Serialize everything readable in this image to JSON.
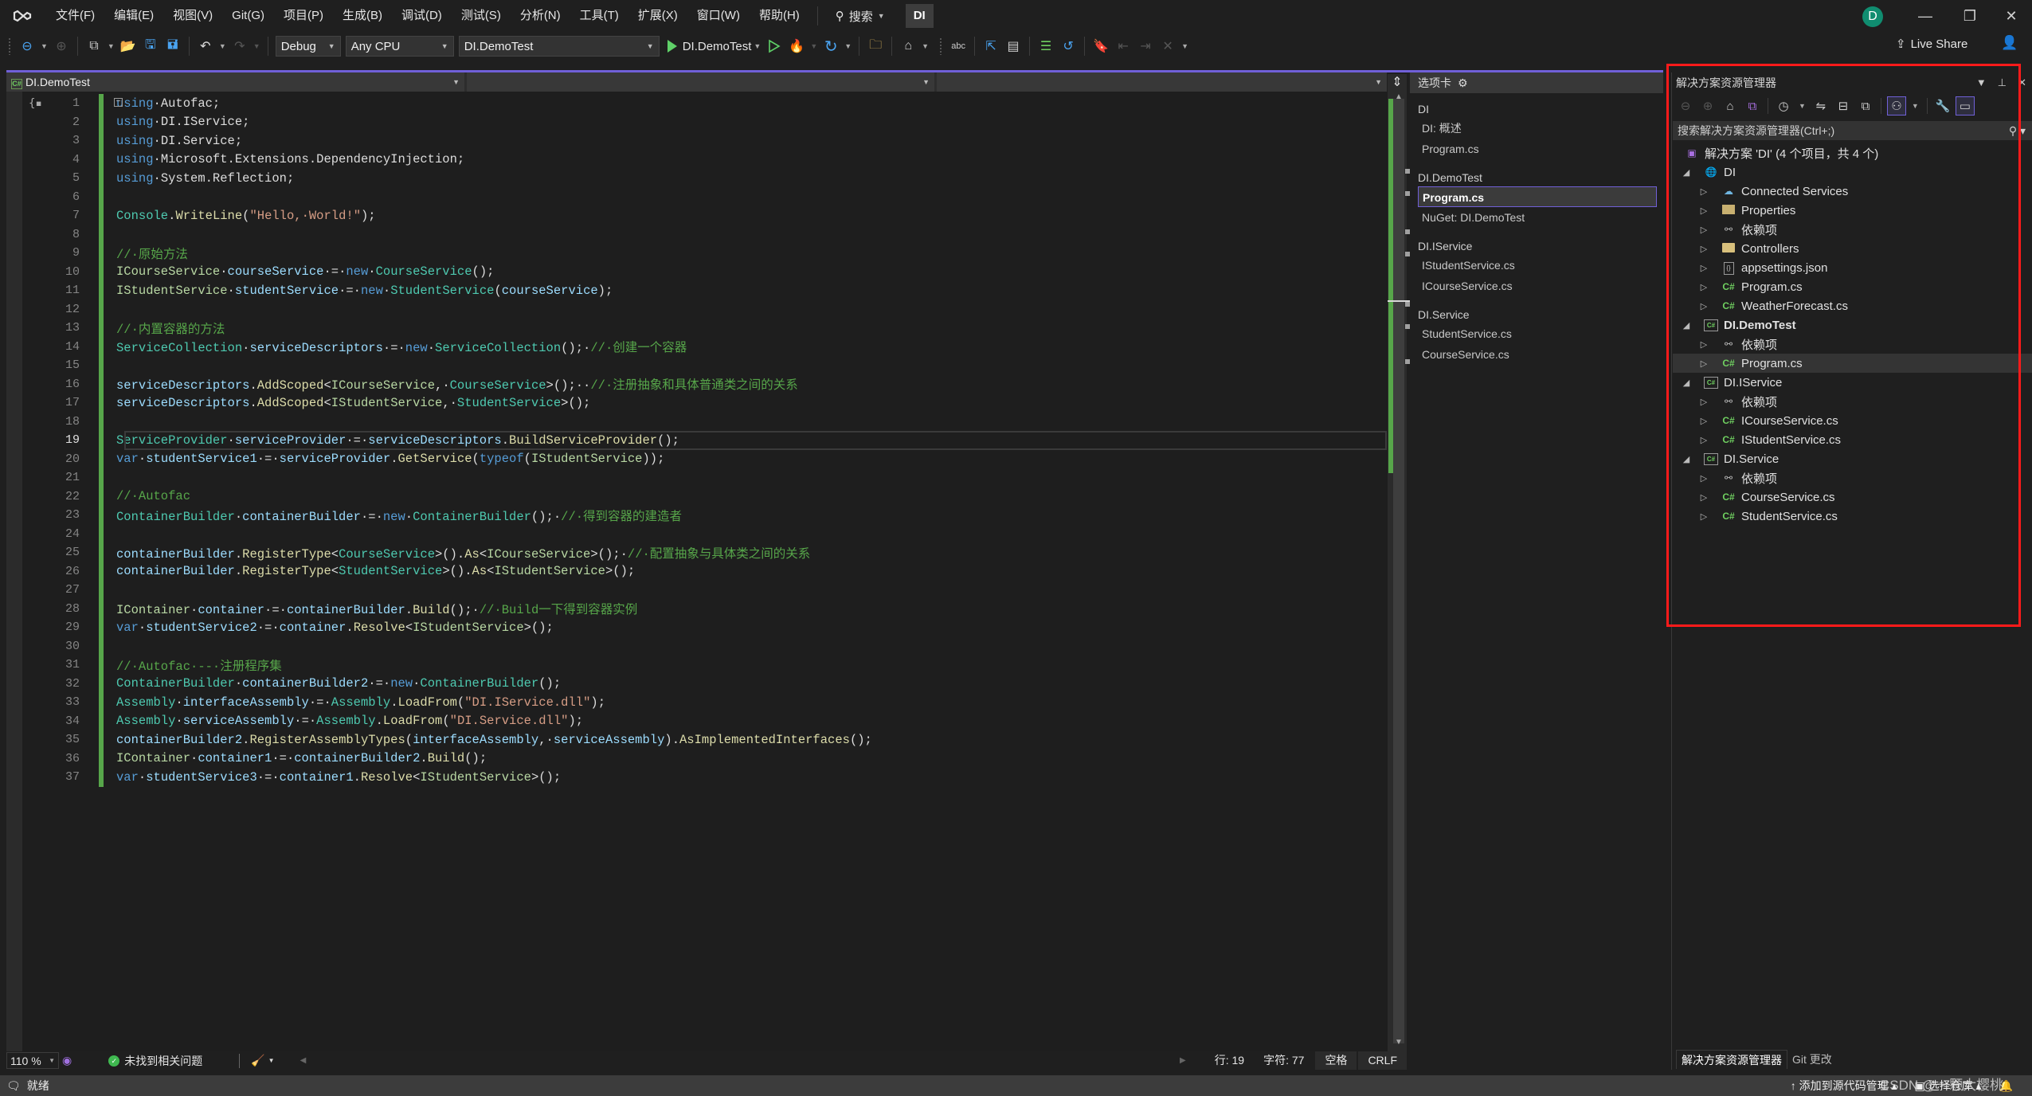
{
  "menubar": {
    "items": [
      "文件(F)",
      "编辑(E)",
      "视图(V)",
      "Git(G)",
      "项目(P)",
      "生成(B)",
      "调试(D)",
      "测试(S)",
      "分析(N)",
      "工具(T)",
      "扩展(X)",
      "窗口(W)",
      "帮助(H)"
    ],
    "search_label": "搜索",
    "solution_badge": "DI",
    "avatar_initial": "D"
  },
  "toolbar": {
    "configuration": "Debug",
    "platform": "Any CPU",
    "startup_project": "DI.DemoTest",
    "run_target": "DI.DemoTest",
    "live_share": "Live Share"
  },
  "editor": {
    "nav": {
      "project": "DI.DemoTest",
      "type": "",
      "member": ""
    },
    "current_line": 19,
    "lines": [
      {
        "n": 1,
        "tokens": [
          [
            "k",
            "using"
          ],
          [
            "",
            "·Autofac;"
          ]
        ]
      },
      {
        "n": 2,
        "tokens": [
          [
            "k",
            "using"
          ],
          [
            "",
            "·DI.IService;"
          ]
        ]
      },
      {
        "n": 3,
        "tokens": [
          [
            "k",
            "using"
          ],
          [
            "",
            "·DI.Service;"
          ]
        ]
      },
      {
        "n": 4,
        "tokens": [
          [
            "k",
            "using"
          ],
          [
            "",
            "·Microsoft.Extensions.DependencyInjection;"
          ]
        ]
      },
      {
        "n": 5,
        "tokens": [
          [
            "k",
            "using"
          ],
          [
            "",
            "·System.Reflection;"
          ]
        ]
      },
      {
        "n": 6,
        "tokens": []
      },
      {
        "n": 7,
        "tokens": [
          [
            "t",
            "Console"
          ],
          [
            "",
            "."
          ],
          [
            "m",
            "WriteLine"
          ],
          [
            "",
            "("
          ],
          [
            "s",
            "\"Hello,·World!\""
          ],
          [
            "",
            ");"
          ]
        ]
      },
      {
        "n": 8,
        "tokens": []
      },
      {
        "n": 9,
        "tokens": [
          [
            "c",
            "//·原始方法"
          ]
        ]
      },
      {
        "n": 10,
        "tokens": [
          [
            "iface",
            "ICourseService"
          ],
          [
            "",
            "·"
          ],
          [
            "v",
            "courseService"
          ],
          [
            "",
            "·=·"
          ],
          [
            "k",
            "new"
          ],
          [
            "",
            "·"
          ],
          [
            "t",
            "CourseService"
          ],
          [
            "",
            "();"
          ]
        ]
      },
      {
        "n": 11,
        "tokens": [
          [
            "iface",
            "IStudentService"
          ],
          [
            "",
            "·"
          ],
          [
            "v",
            "studentService"
          ],
          [
            "",
            "·=·"
          ],
          [
            "k",
            "new"
          ],
          [
            "",
            "·"
          ],
          [
            "t",
            "StudentService"
          ],
          [
            "",
            "("
          ],
          [
            "v",
            "courseService"
          ],
          [
            "",
            ");"
          ]
        ]
      },
      {
        "n": 12,
        "tokens": []
      },
      {
        "n": 13,
        "tokens": [
          [
            "c",
            "//·内置容器的方法"
          ]
        ]
      },
      {
        "n": 14,
        "tokens": [
          [
            "t",
            "ServiceCollection"
          ],
          [
            "",
            "·"
          ],
          [
            "v",
            "serviceDescriptors"
          ],
          [
            "",
            "·=·"
          ],
          [
            "k",
            "new"
          ],
          [
            "",
            "·"
          ],
          [
            "t",
            "ServiceCollection"
          ],
          [
            "",
            "();·"
          ],
          [
            "c",
            "//·创建一个容器"
          ]
        ]
      },
      {
        "n": 15,
        "tokens": []
      },
      {
        "n": 16,
        "tokens": [
          [
            "v",
            "serviceDescriptors"
          ],
          [
            "",
            "."
          ],
          [
            "m",
            "AddScoped"
          ],
          [
            "",
            "<"
          ],
          [
            "iface",
            "ICourseService"
          ],
          [
            "",
            ",·"
          ],
          [
            "t",
            "CourseService"
          ],
          [
            "",
            ">();··"
          ],
          [
            "c",
            "//·注册抽象和具体普通类之间的关系"
          ]
        ]
      },
      {
        "n": 17,
        "tokens": [
          [
            "v",
            "serviceDescriptors"
          ],
          [
            "",
            "."
          ],
          [
            "m",
            "AddScoped"
          ],
          [
            "",
            "<"
          ],
          [
            "iface",
            "IStudentService"
          ],
          [
            "",
            ",·"
          ],
          [
            "t",
            "StudentService"
          ],
          [
            "",
            ">();"
          ]
        ]
      },
      {
        "n": 18,
        "tokens": []
      },
      {
        "n": 19,
        "tokens": [
          [
            "t",
            "ServiceProvider"
          ],
          [
            "",
            "·"
          ],
          [
            "v",
            "serviceProvider"
          ],
          [
            "",
            "·=·"
          ],
          [
            "v",
            "serviceDescriptors"
          ],
          [
            "",
            "."
          ],
          [
            "m",
            "BuildServiceProvider"
          ],
          [
            "",
            "();"
          ]
        ]
      },
      {
        "n": 20,
        "tokens": [
          [
            "k",
            "var"
          ],
          [
            "",
            "·"
          ],
          [
            "v",
            "studentService1"
          ],
          [
            "",
            "·=·"
          ],
          [
            "v",
            "serviceProvider"
          ],
          [
            "",
            "."
          ],
          [
            "m",
            "GetService"
          ],
          [
            "",
            "("
          ],
          [
            "k",
            "typeof"
          ],
          [
            "",
            "("
          ],
          [
            "iface",
            "IStudentService"
          ],
          [
            "",
            "));"
          ]
        ]
      },
      {
        "n": 21,
        "tokens": []
      },
      {
        "n": 22,
        "tokens": [
          [
            "c",
            "//·Autofac"
          ]
        ]
      },
      {
        "n": 23,
        "tokens": [
          [
            "t",
            "ContainerBuilder"
          ],
          [
            "",
            "·"
          ],
          [
            "v",
            "containerBuilder"
          ],
          [
            "",
            "·=·"
          ],
          [
            "k",
            "new"
          ],
          [
            "",
            "·"
          ],
          [
            "t",
            "ContainerBuilder"
          ],
          [
            "",
            "();·"
          ],
          [
            "c",
            "//·得到容器的建造者"
          ]
        ]
      },
      {
        "n": 24,
        "tokens": []
      },
      {
        "n": 25,
        "tokens": [
          [
            "v",
            "containerBuilder"
          ],
          [
            "",
            "."
          ],
          [
            "m",
            "RegisterType"
          ],
          [
            "",
            "<"
          ],
          [
            "t",
            "CourseService"
          ],
          [
            "",
            ">()."
          ],
          [
            "m",
            "As"
          ],
          [
            "",
            "<"
          ],
          [
            "iface",
            "ICourseService"
          ],
          [
            "",
            ">();·"
          ],
          [
            "c",
            "//·配置抽象与具体类之间的关系"
          ]
        ]
      },
      {
        "n": 26,
        "tokens": [
          [
            "v",
            "containerBuilder"
          ],
          [
            "",
            "."
          ],
          [
            "m",
            "RegisterType"
          ],
          [
            "",
            "<"
          ],
          [
            "t",
            "StudentService"
          ],
          [
            "",
            ">()."
          ],
          [
            "m",
            "As"
          ],
          [
            "",
            "<"
          ],
          [
            "iface",
            "IStudentService"
          ],
          [
            "",
            ">();"
          ]
        ]
      },
      {
        "n": 27,
        "tokens": []
      },
      {
        "n": 28,
        "tokens": [
          [
            "iface",
            "IContainer"
          ],
          [
            "",
            "·"
          ],
          [
            "v",
            "container"
          ],
          [
            "",
            "·=·"
          ],
          [
            "v",
            "containerBuilder"
          ],
          [
            "",
            "."
          ],
          [
            "m",
            "Build"
          ],
          [
            "",
            "();·"
          ],
          [
            "c",
            "//·Build一下得到容器实例"
          ]
        ]
      },
      {
        "n": 29,
        "tokens": [
          [
            "k",
            "var"
          ],
          [
            "",
            "·"
          ],
          [
            "v",
            "studentService2"
          ],
          [
            "",
            "·=·"
          ],
          [
            "v",
            "container"
          ],
          [
            "",
            "."
          ],
          [
            "m",
            "Resolve"
          ],
          [
            "",
            "<"
          ],
          [
            "iface",
            "IStudentService"
          ],
          [
            "",
            ">();"
          ]
        ]
      },
      {
        "n": 30,
        "tokens": []
      },
      {
        "n": 31,
        "tokens": [
          [
            "c",
            "//·Autofac·--·注册程序集"
          ]
        ]
      },
      {
        "n": 32,
        "tokens": [
          [
            "t",
            "ContainerBuilder"
          ],
          [
            "",
            "·"
          ],
          [
            "v",
            "containerBuilder2"
          ],
          [
            "",
            "·=·"
          ],
          [
            "k",
            "new"
          ],
          [
            "",
            "·"
          ],
          [
            "t",
            "ContainerBuilder"
          ],
          [
            "",
            "();"
          ]
        ]
      },
      {
        "n": 33,
        "tokens": [
          [
            "t",
            "Assembly"
          ],
          [
            "",
            "·"
          ],
          [
            "v",
            "interfaceAssembly"
          ],
          [
            "",
            "·=·"
          ],
          [
            "t",
            "Assembly"
          ],
          [
            "",
            "."
          ],
          [
            "m",
            "LoadFrom"
          ],
          [
            "",
            "("
          ],
          [
            "s",
            "\"DI.IService.dll\""
          ],
          [
            "",
            ");"
          ]
        ]
      },
      {
        "n": 34,
        "tokens": [
          [
            "t",
            "Assembly"
          ],
          [
            "",
            "·"
          ],
          [
            "v",
            "serviceAssembly"
          ],
          [
            "",
            "·=·"
          ],
          [
            "t",
            "Assembly"
          ],
          [
            "",
            "."
          ],
          [
            "m",
            "LoadFrom"
          ],
          [
            "",
            "("
          ],
          [
            "s",
            "\"DI.Service.dll\""
          ],
          [
            "",
            ");"
          ]
        ]
      },
      {
        "n": 35,
        "tokens": [
          [
            "v",
            "containerBuilder2"
          ],
          [
            "",
            "."
          ],
          [
            "m",
            "RegisterAssemblyTypes"
          ],
          [
            "",
            "("
          ],
          [
            "v",
            "interfaceAssembly"
          ],
          [
            "",
            ",·"
          ],
          [
            "v",
            "serviceAssembly"
          ],
          [
            "",
            ")."
          ],
          [
            "m",
            "AsImplementedInterfaces"
          ],
          [
            "",
            "();"
          ]
        ]
      },
      {
        "n": 36,
        "tokens": [
          [
            "iface",
            "IContainer"
          ],
          [
            "",
            "·"
          ],
          [
            "v",
            "container1"
          ],
          [
            "",
            "·=·"
          ],
          [
            "v",
            "containerBuilder2"
          ],
          [
            "",
            "."
          ],
          [
            "m",
            "Build"
          ],
          [
            "",
            "();"
          ]
        ]
      },
      {
        "n": 37,
        "tokens": [
          [
            "k",
            "var"
          ],
          [
            "",
            "·"
          ],
          [
            "v",
            "studentService3"
          ],
          [
            "",
            "·=·"
          ],
          [
            "v",
            "container1"
          ],
          [
            "",
            "."
          ],
          [
            "m",
            "Resolve"
          ],
          [
            "",
            "<"
          ],
          [
            "iface",
            "IStudentService"
          ],
          [
            "",
            ">();"
          ]
        ]
      }
    ]
  },
  "editor_status": {
    "zoom": "110 %",
    "issues": "未找到相关问题",
    "line": "行: 19",
    "char": "字符: 77",
    "indent": "空格",
    "eol": "CRLF"
  },
  "tabs_panel": {
    "title": "选项卡",
    "groups": [
      {
        "name": "DI",
        "items": [
          {
            "label": "DI: 概述",
            "active": false
          },
          {
            "label": "Program.cs",
            "active": false
          }
        ]
      },
      {
        "name": "DI.DemoTest",
        "items": [
          {
            "label": "Program.cs",
            "active": true
          },
          {
            "label": "NuGet: DI.DemoTest",
            "active": false
          }
        ]
      },
      {
        "name": "DI.IService",
        "items": [
          {
            "label": "IStudentService.cs",
            "active": false
          },
          {
            "label": "ICourseService.cs",
            "active": false
          }
        ]
      },
      {
        "name": "DI.Service",
        "items": [
          {
            "label": "StudentService.cs",
            "active": false
          },
          {
            "label": "CourseService.cs",
            "active": false
          }
        ]
      }
    ]
  },
  "solution_explorer": {
    "title": "解决方案资源管理器",
    "search_placeholder": "搜索解决方案资源管理器(Ctrl+;)",
    "tree": [
      {
        "label": "解决方案 'DI' (4 个项目，共 4 个)",
        "level": 0,
        "icon": "solution",
        "expander": "none"
      },
      {
        "label": "DI",
        "level": 1,
        "icon": "web-project",
        "expander": "expanded"
      },
      {
        "label": "Connected Services",
        "level": 2,
        "icon": "connected-services",
        "expander": "collapsed"
      },
      {
        "label": "Properties",
        "level": 2,
        "icon": "properties",
        "expander": "collapsed"
      },
      {
        "label": "依赖项",
        "level": 2,
        "icon": "dependencies",
        "expander": "collapsed"
      },
      {
        "label": "Controllers",
        "level": 2,
        "icon": "folder",
        "expander": "collapsed"
      },
      {
        "label": "appsettings.json",
        "level": 2,
        "icon": "json",
        "expander": "collapsed"
      },
      {
        "label": "Program.cs",
        "level": 2,
        "icon": "csharp",
        "expander": "collapsed"
      },
      {
        "label": "WeatherForecast.cs",
        "level": 2,
        "icon": "csharp",
        "expander": "collapsed"
      },
      {
        "label": "DI.DemoTest",
        "level": 1,
        "icon": "csharp-project",
        "expander": "expanded",
        "bold": true
      },
      {
        "label": "依赖项",
        "level": 2,
        "icon": "dependencies",
        "expander": "collapsed"
      },
      {
        "label": "Program.cs",
        "level": 2,
        "icon": "csharp",
        "expander": "collapsed",
        "selected": true
      },
      {
        "label": "DI.IService",
        "level": 1,
        "icon": "csharp-project",
        "expander": "expanded"
      },
      {
        "label": "依赖项",
        "level": 2,
        "icon": "dependencies",
        "expander": "collapsed"
      },
      {
        "label": "ICourseService.cs",
        "level": 2,
        "icon": "csharp",
        "expander": "collapsed"
      },
      {
        "label": "IStudentService.cs",
        "level": 2,
        "icon": "csharp",
        "expander": "collapsed"
      },
      {
        "label": "DI.Service",
        "level": 1,
        "icon": "csharp-project",
        "expander": "expanded"
      },
      {
        "label": "依赖项",
        "level": 2,
        "icon": "dependencies",
        "expander": "collapsed"
      },
      {
        "label": "CourseService.cs",
        "level": 2,
        "icon": "csharp",
        "expander": "collapsed"
      },
      {
        "label": "StudentService.cs",
        "level": 2,
        "icon": "csharp",
        "expander": "collapsed"
      }
    ],
    "bottom_tabs": [
      "解决方案资源管理器",
      "Git 更改"
    ]
  },
  "app_status": {
    "ready": "就绪",
    "add_to_source_control": "添加到源代码管理",
    "select_repo": "选择仓库"
  },
  "watermark": "CSDN @一颗大樱桃",
  "colors": {
    "accent": "#7060d8",
    "highlight_box": "#ff1a1a",
    "change_bar": "#57a64a"
  }
}
